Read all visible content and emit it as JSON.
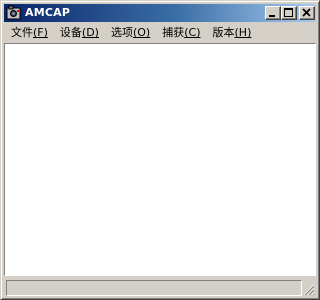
{
  "window": {
    "title": "AMCAP",
    "icon": "camera-app-icon",
    "title_gradient_start": "#0a246a",
    "title_gradient_end": "#a6caf0",
    "face_color": "#d4d0c8"
  },
  "caption_buttons": {
    "minimize": "minimize-icon",
    "maximize": "maximize-icon",
    "close": "close-icon"
  },
  "menu": {
    "items": [
      {
        "label": "文件",
        "key": "(F)"
      },
      {
        "label": "设备",
        "key": "(D)"
      },
      {
        "label": "选项",
        "key": "(O)"
      },
      {
        "label": "捕获",
        "key": "(C)"
      },
      {
        "label": "版本",
        "key": "(H)"
      }
    ]
  },
  "client_area": {
    "background": "#ffffff"
  },
  "status_bar": {
    "text": ""
  }
}
